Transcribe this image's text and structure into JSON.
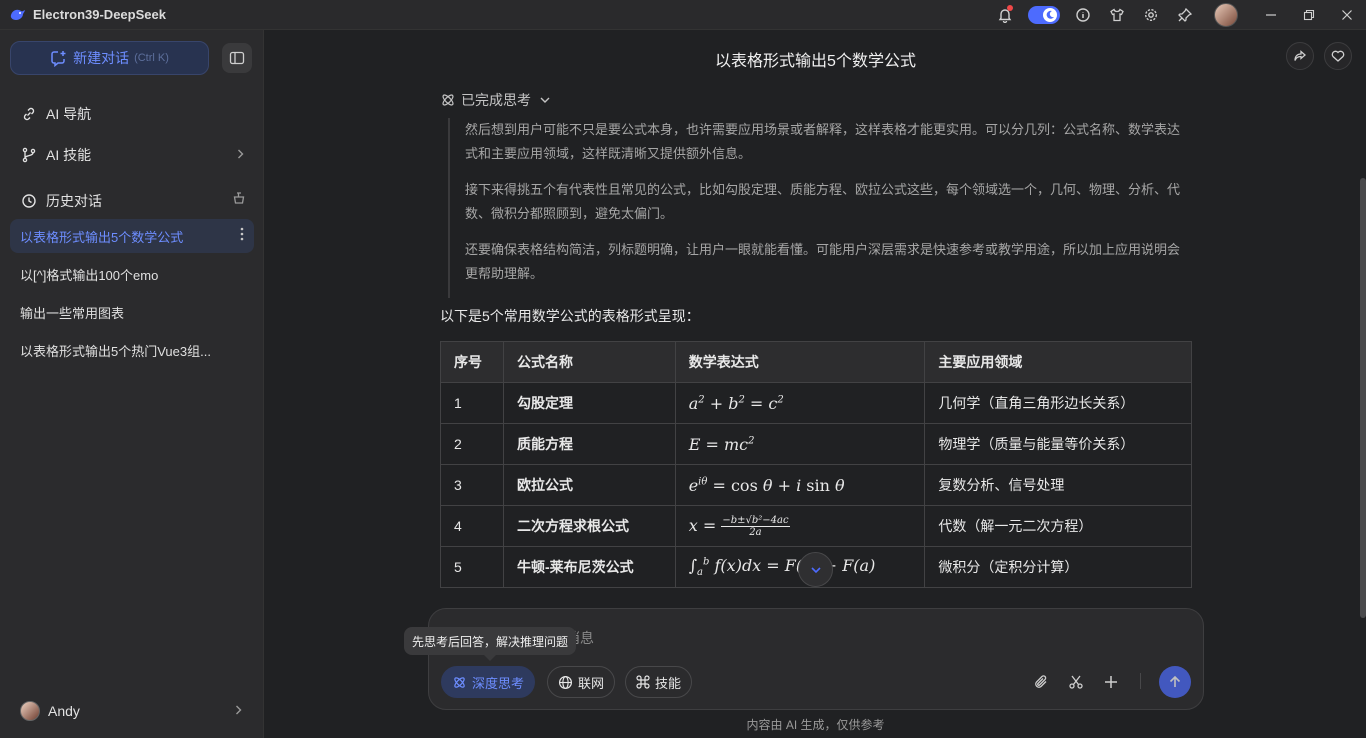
{
  "titlebar": {
    "title": "Electron39-DeepSeek"
  },
  "sidebar": {
    "new_chat_label": "新建对话",
    "new_chat_shortcut": "(Ctrl K)",
    "nav": [
      {
        "label": "AI 导航",
        "icon": "link-icon"
      },
      {
        "label": "AI 技能",
        "icon": "branch-icon"
      }
    ],
    "history_label": "历史对话",
    "history": [
      {
        "label": "以表格形式输出5个数学公式",
        "active": true
      },
      {
        "label": "以[^]格式输出100个emo"
      },
      {
        "label": "输出一些常用图表"
      },
      {
        "label": "以表格形式输出5个热门Vue3组..."
      }
    ],
    "user_name": "Andy"
  },
  "main": {
    "title": "以表格形式输出5个数学公式",
    "think_label": "已完成思考",
    "think_paragraphs": [
      "然后想到用户可能不只是要公式本身，也许需要应用场景或者解释，这样表格才能更实用。可以分几列：公式名称、数学表达式和主要应用领域，这样既清晰又提供额外信息。",
      "接下来得挑五个有代表性且常见的公式，比如勾股定理、质能方程、欧拉公式这些，每个领域选一个，几何、物理、分析、代数、微积分都照顾到，避免太偏门。",
      "还要确保表格结构简洁，列标题明确，让用户一眼就能看懂。可能用户深层需求是快速参考或教学用途，所以加上应用说明会更帮助理解。"
    ],
    "intro": "以下是5个常用数学公式的表格形式呈现：",
    "table": {
      "headers": [
        "序号",
        "公式名称",
        "数学表达式",
        "主要应用领域"
      ],
      "rows": [
        {
          "num": "1",
          "name": "勾股定理",
          "field": "几何学（直角三角形边长关系）"
        },
        {
          "num": "2",
          "name": "质能方程",
          "field": "物理学（质量与能量等价关系）"
        },
        {
          "num": "3",
          "name": "欧拉公式",
          "field": "复数分析、信号处理"
        },
        {
          "num": "4",
          "name": "二次方程求根公式",
          "field": "代数（解一元二次方程）"
        },
        {
          "num": "5",
          "name": "牛顿-莱布尼茨公式",
          "field": "微积分（定积分计算）"
        }
      ]
    }
  },
  "composer": {
    "placeholder": "消息",
    "tooltip": "先思考后回答，解决推理问题",
    "deep_think": "深度思考",
    "web": "联网",
    "skills": "技能"
  },
  "disclaimer": "内容由 AI 生成，仅供参考",
  "colors": {
    "accent": "#4d6bfe",
    "background": "#202123",
    "sidebar": "#2b2b2d"
  }
}
